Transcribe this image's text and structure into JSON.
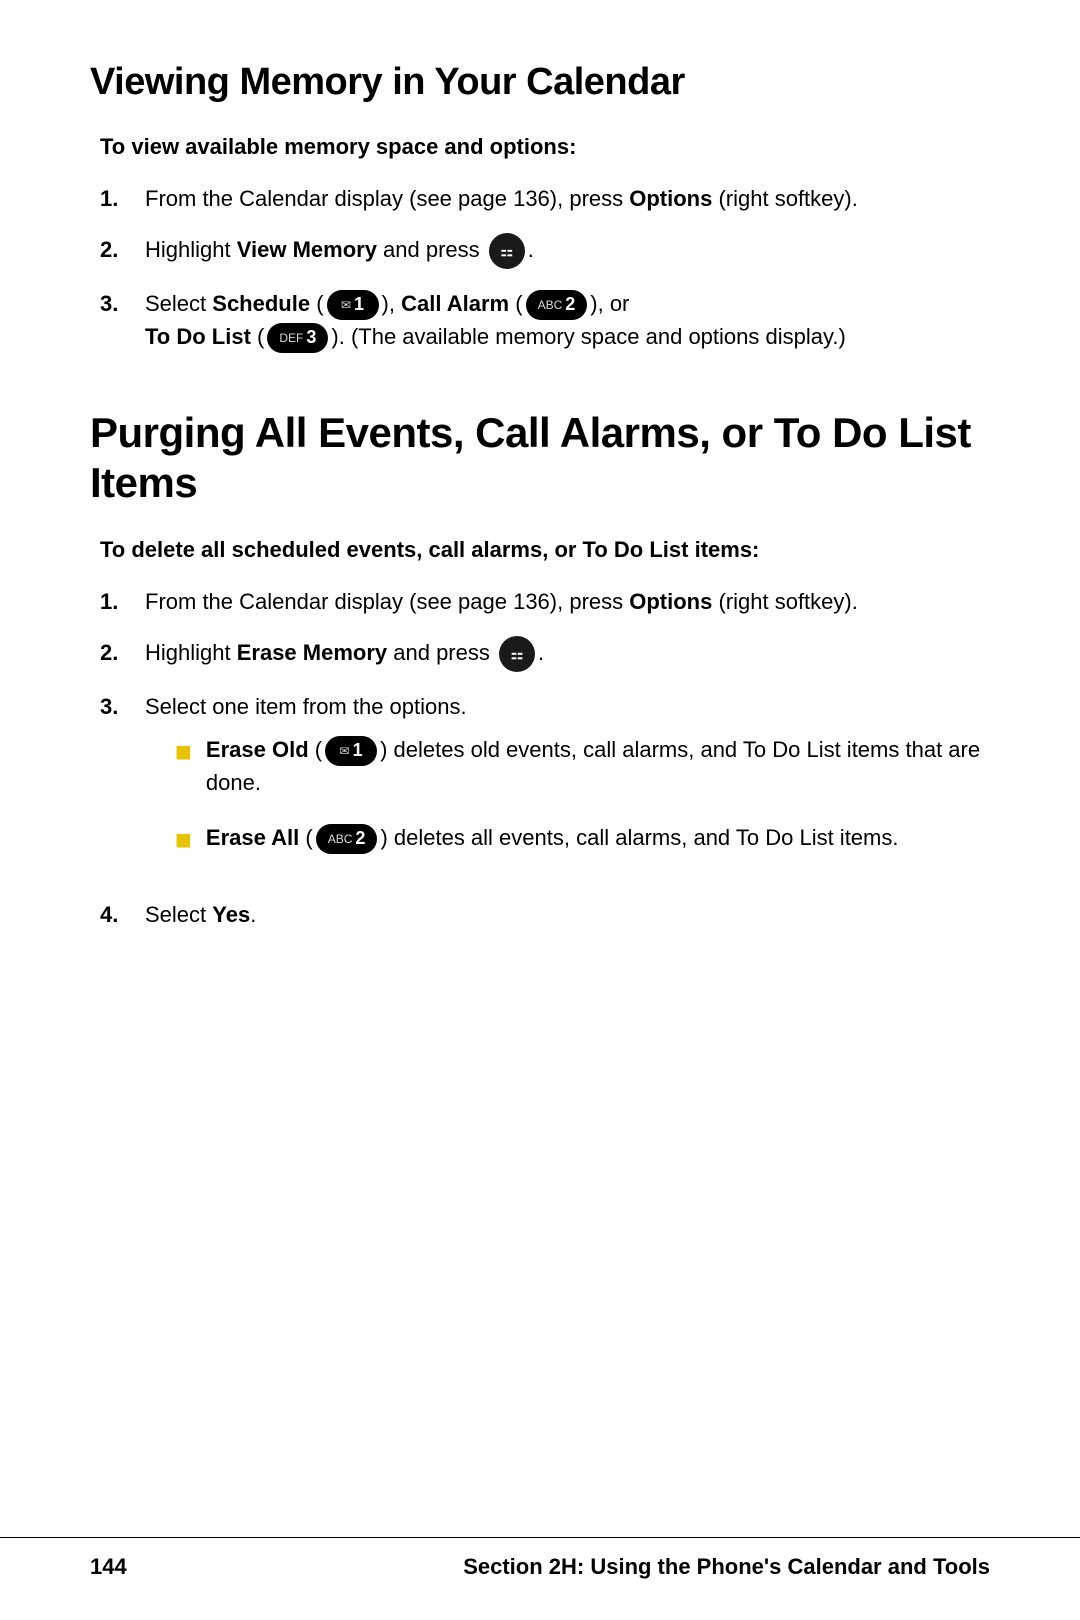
{
  "section1": {
    "title": "Viewing Memory in Your Calendar",
    "subtitle": "To view available memory space and options:",
    "steps": [
      {
        "number": "1.",
        "text_before": "From the Calendar display (see page 136), press ",
        "bold_text": "Options",
        "text_after": " (right softkey)."
      },
      {
        "number": "2.",
        "text_before": "Highlight ",
        "bold_text": "View Memory",
        "text_after": " and press ",
        "icon": "menu"
      },
      {
        "number": "3.",
        "text_before": "Select ",
        "bold_text": "Schedule",
        "badge1_prefix": "☑",
        "badge1_num": "1",
        "mid_text": ", ",
        "bold2": "Call Alarm",
        "badge2_prefix": "ABC",
        "badge2_num": "2",
        "end_text": ", or",
        "line2_bold": "To Do List",
        "badge3_prefix": "DEF",
        "badge3_num": "3",
        "line2_end": ". (The available memory space and options display.)"
      }
    ]
  },
  "section2": {
    "title": "Purging All Events, Call Alarms, or To Do List Items",
    "subtitle": "To delete all scheduled events, call alarms, or To Do List items:",
    "steps": [
      {
        "number": "1.",
        "text_before": "From the Calendar display (see page 136), press ",
        "bold_text": "Options",
        "text_after": " (right softkey)."
      },
      {
        "number": "2.",
        "text_before": "Highlight ",
        "bold_text": "Erase Memory",
        "text_after": " and press ",
        "icon": "menu"
      },
      {
        "number": "3.",
        "text": "Select one item from the options."
      }
    ],
    "bullets": [
      {
        "bold": "Erase Old",
        "badge_prefix": "☑",
        "badge_num": "1",
        "text": " deletes old events, call alarms, and To Do List items that are done."
      },
      {
        "bold": "Erase All",
        "badge_prefix": "ABC",
        "badge_num": "2",
        "text": " deletes all events, call alarms, and To Do List items."
      }
    ],
    "step4": {
      "number": "4.",
      "text_before": "Select ",
      "bold_text": "Yes",
      "text_after": "."
    }
  },
  "footer": {
    "page_number": "144",
    "section_label": "Section 2H: Using the Phone's Calendar and Tools"
  }
}
